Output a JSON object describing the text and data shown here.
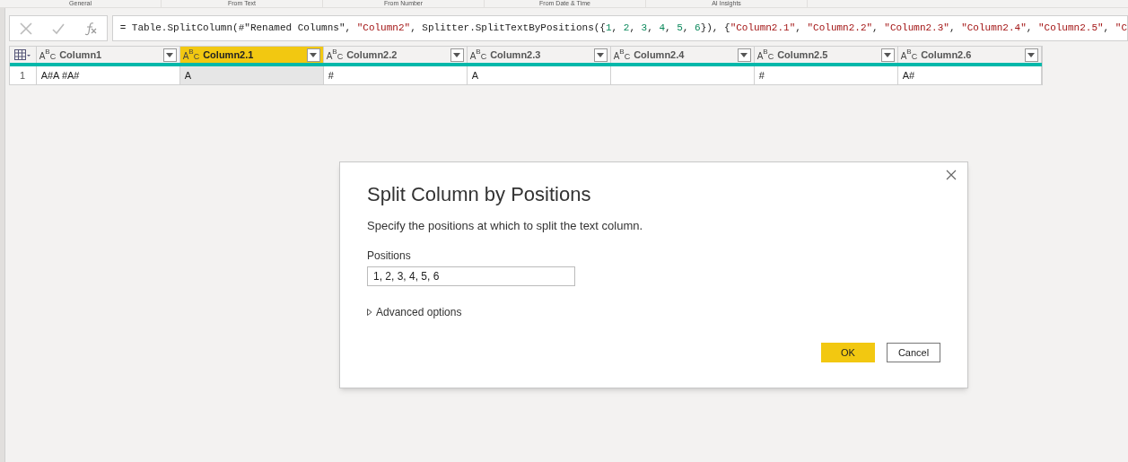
{
  "ribbon_groups": [
    "General",
    "From Text",
    "From Number",
    "From Date & Time",
    "AI Insights"
  ],
  "formula_bar": {
    "tokens": [
      {
        "kind": "plain",
        "text": "= Table.SplitColumn(#\"Renamed Columns\", "
      },
      {
        "kind": "string",
        "text": "\"Column2\""
      },
      {
        "kind": "plain",
        "text": ", Splitter.SplitTextByPositions({"
      },
      {
        "kind": "number",
        "text": "1"
      },
      {
        "kind": "plain",
        "text": ", "
      },
      {
        "kind": "number",
        "text": "2"
      },
      {
        "kind": "plain",
        "text": ", "
      },
      {
        "kind": "number",
        "text": "3"
      },
      {
        "kind": "plain",
        "text": ", "
      },
      {
        "kind": "number",
        "text": "4"
      },
      {
        "kind": "plain",
        "text": ", "
      },
      {
        "kind": "number",
        "text": "5"
      },
      {
        "kind": "plain",
        "text": ", "
      },
      {
        "kind": "number",
        "text": "6"
      },
      {
        "kind": "plain",
        "text": "}), {"
      },
      {
        "kind": "string",
        "text": "\"Column2.1\""
      },
      {
        "kind": "plain",
        "text": ", "
      },
      {
        "kind": "string",
        "text": "\"Column2.2\""
      },
      {
        "kind": "plain",
        "text": ", "
      },
      {
        "kind": "string",
        "text": "\"Column2.3\""
      },
      {
        "kind": "plain",
        "text": ", "
      },
      {
        "kind": "string",
        "text": "\"Column2.4\""
      },
      {
        "kind": "plain",
        "text": ", "
      },
      {
        "kind": "string",
        "text": "\"Column2.5\""
      },
      {
        "kind": "plain",
        "text": ", "
      },
      {
        "kind": "string",
        "text": "\"C"
      }
    ]
  },
  "table": {
    "columns": [
      {
        "type": "ABC",
        "name": "Column1",
        "selected": false
      },
      {
        "type": "ABC",
        "name": "Column2.1",
        "selected": true
      },
      {
        "type": "ABC",
        "name": "Column2.2",
        "selected": false
      },
      {
        "type": "ABC",
        "name": "Column2.3",
        "selected": false
      },
      {
        "type": "ABC",
        "name": "Column2.4",
        "selected": false
      },
      {
        "type": "ABC",
        "name": "Column2.5",
        "selected": false
      },
      {
        "type": "ABC",
        "name": "Column2.6",
        "selected": false
      }
    ],
    "rows": [
      {
        "number": "1",
        "cells": [
          "A#A #A#",
          "A",
          "#",
          "A",
          "",
          "#",
          "A#"
        ]
      }
    ]
  },
  "dialog": {
    "title": "Split Column by Positions",
    "description": "Specify the positions at which to split the text column.",
    "field_label": "Positions",
    "field_value": "1, 2, 3, 4, 5, 6",
    "advanced": {
      "label": "Advanced options",
      "expanded": false
    },
    "buttons": [
      {
        "label": "OK",
        "kind": "primary"
      },
      {
        "label": "Cancel",
        "kind": "secondary"
      }
    ]
  }
}
